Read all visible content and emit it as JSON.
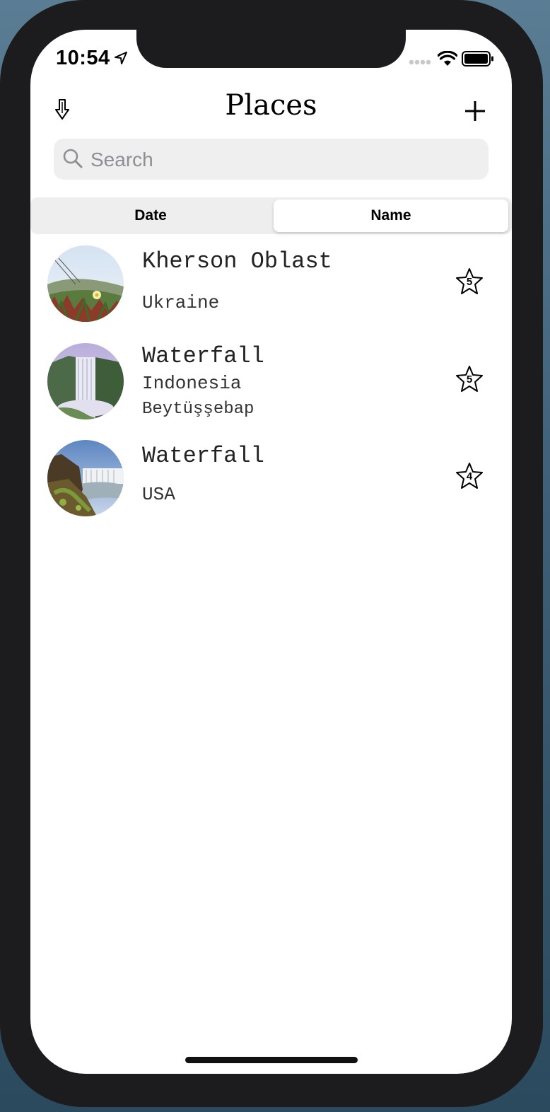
{
  "status_bar": {
    "time": "10:54"
  },
  "nav": {
    "title": "Places"
  },
  "search": {
    "placeholder": "Search",
    "value": ""
  },
  "sort": {
    "options": [
      "Date",
      "Name"
    ],
    "selected": "Name"
  },
  "places": [
    {
      "name": "Kherson Oblast",
      "country": "Ukraine",
      "locality": "",
      "rating": "5",
      "thumbnail": "flower-field-photo"
    },
    {
      "name": "Waterfall",
      "country": "Indonesia",
      "locality": "Beytüşşebap",
      "rating": "5",
      "thumbnail": "waterfall-cliff-photo"
    },
    {
      "name": "Waterfall",
      "country": "USA",
      "locality": "",
      "rating": "4",
      "thumbnail": "waterfall-rocks-photo"
    }
  ],
  "colors": {
    "search_bg": "#efeff0",
    "placeholder": "#8e8e93",
    "device_frame": "#1c1c1e"
  }
}
